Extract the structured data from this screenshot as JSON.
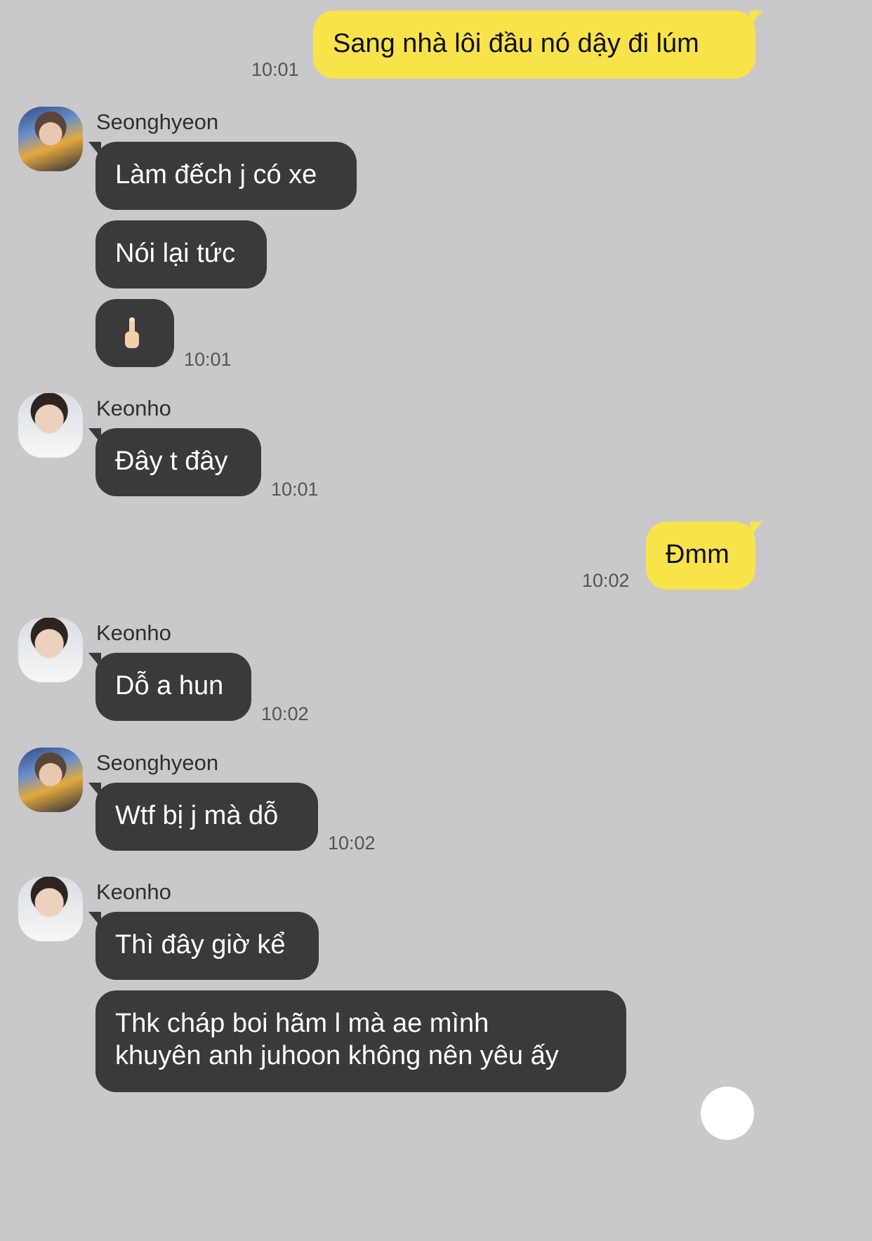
{
  "messages": {
    "m1": {
      "text": "Sang nhà lôi đầu nó dậy đi lúm",
      "time": "10:01"
    },
    "m2": {
      "sender": "Seonghyeon",
      "line1": "Làm đếch j có xe",
      "line2": "Nói lại tức",
      "emoji": "🖕",
      "time": "10:01"
    },
    "m3": {
      "sender": "Keonho",
      "text": "Đây t đây",
      "time": "10:01"
    },
    "m4": {
      "text": "Đmm",
      "time": "10:02"
    },
    "m5": {
      "sender": "Keonho",
      "text": "Dỗ a hun",
      "time": "10:02"
    },
    "m6": {
      "sender": "Seonghyeon",
      "text": "Wtf bị j mà dỗ",
      "time": "10:02"
    },
    "m7": {
      "sender": "Keonho",
      "line1": "Thì đây giờ kể",
      "line2a": "Thk cháp boi hãm l mà ae mình",
      "line2b": "khuyên anh juhoon không nên yêu ấy"
    }
  },
  "colors": {
    "background": "#c9c9cb",
    "bubble_incoming": "#3a3a3c",
    "bubble_outgoing": "#f9e34b"
  }
}
